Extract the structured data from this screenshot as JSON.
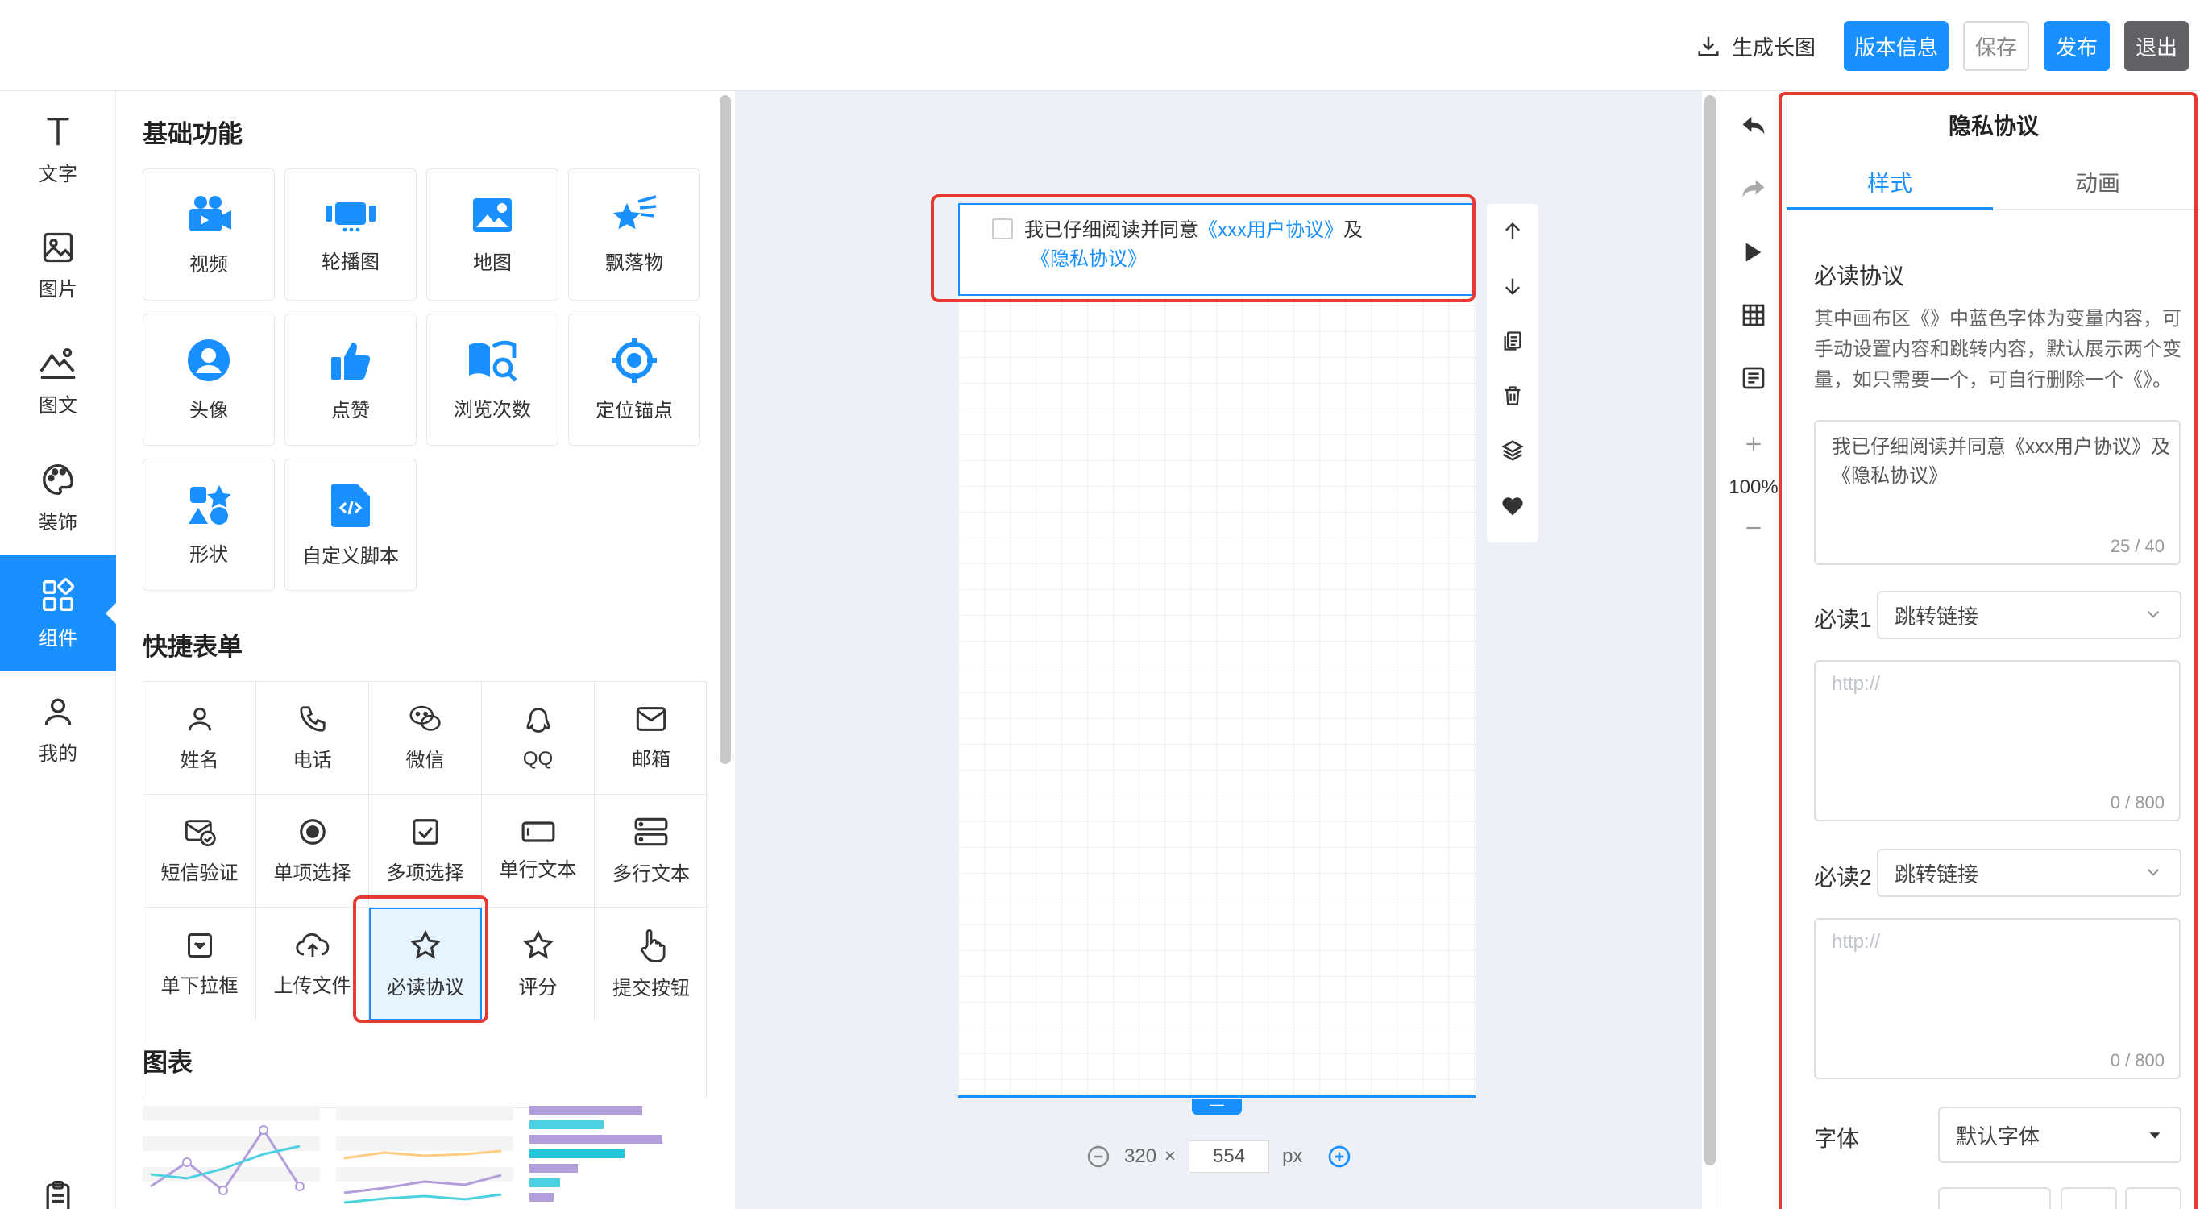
{
  "topbar": {
    "generate_label": "生成长图",
    "version_label": "版本信息",
    "save_label": "保存",
    "publish_label": "发布",
    "exit_label": "退出"
  },
  "rail": {
    "items": [
      {
        "label": "文字",
        "icon": "text-icon"
      },
      {
        "label": "图片",
        "icon": "image-icon"
      },
      {
        "label": "图文",
        "icon": "image-text-icon"
      },
      {
        "label": "装饰",
        "icon": "palette-icon"
      },
      {
        "label": "组件",
        "icon": "components-icon",
        "active": true
      },
      {
        "label": "我的",
        "icon": "user-icon"
      }
    ]
  },
  "panel": {
    "basic_title": "基础功能",
    "basic": [
      {
        "label": "视频",
        "icon": "video-camera-icon"
      },
      {
        "label": "轮播图",
        "icon": "carousel-icon"
      },
      {
        "label": "地图",
        "icon": "map-icon"
      },
      {
        "label": "飘落物",
        "icon": "falling-star-icon"
      },
      {
        "label": "头像",
        "icon": "avatar-icon"
      },
      {
        "label": "点赞",
        "icon": "thumbs-up-icon"
      },
      {
        "label": "浏览次数",
        "icon": "view-count-icon"
      },
      {
        "label": "定位锚点",
        "icon": "anchor-target-icon"
      },
      {
        "label": "形状",
        "icon": "shapes-icon"
      },
      {
        "label": "自定义脚本",
        "icon": "code-file-icon"
      }
    ],
    "form_title": "快捷表单",
    "form": [
      {
        "label": "姓名",
        "icon": "person-icon"
      },
      {
        "label": "电话",
        "icon": "phone-icon"
      },
      {
        "label": "微信",
        "icon": "wechat-icon"
      },
      {
        "label": "QQ",
        "icon": "qq-icon"
      },
      {
        "label": "邮箱",
        "icon": "mail-icon"
      },
      {
        "label": "短信验证",
        "icon": "sms-verify-icon"
      },
      {
        "label": "单项选择",
        "icon": "radio-icon"
      },
      {
        "label": "多项选择",
        "icon": "checkbox-icon"
      },
      {
        "label": "单行文本",
        "icon": "single-line-input-icon"
      },
      {
        "label": "多行文本",
        "icon": "multi-line-input-icon"
      },
      {
        "label": "单下拉框",
        "icon": "dropdown-icon"
      },
      {
        "label": "上传文件",
        "icon": "cloud-upload-icon"
      },
      {
        "label": "必读协议",
        "icon": "star-icon",
        "selected": true
      },
      {
        "label": "评分",
        "icon": "star-outline-icon"
      },
      {
        "label": "提交按钮",
        "icon": "pointer-hand-icon"
      }
    ],
    "chart_title": "图表"
  },
  "canvas": {
    "agreement": {
      "prefix": "我已仔细阅读并同意",
      "link1": "《xxx用户协议》",
      "joiner": "及",
      "link2": "《隐私协议》"
    },
    "width": "320",
    "times": "×",
    "height_value": "554",
    "unit": "px",
    "handle": "—"
  },
  "right_tools": {
    "zoom": "100%"
  },
  "props": {
    "title": "隐私协议",
    "tab_style": "样式",
    "tab_anim": "动画",
    "section_label": "必读协议",
    "description": "其中画布区《》中蓝色字体为变量内容，可手动设置内容和跳转内容，默认展示两个变量，如只需要一个，可自行删除一个《》。",
    "content_value": "我已仔细阅读并同意《xxx用户协议》及《隐私协议》",
    "content_count": "25 / 40",
    "read1_label": "必读1",
    "read1_select": "跳转链接",
    "read1_placeholder": "http://",
    "read1_count": "0 / 800",
    "read2_label": "必读2",
    "read2_select": "跳转链接",
    "read2_placeholder": "http://",
    "read2_count": "0 / 800",
    "font_label": "字体",
    "font_select": "默认字体"
  },
  "colors": {
    "accent": "#1890ff",
    "highlight_red": "#e63a30",
    "exit_gray": "#606266"
  }
}
